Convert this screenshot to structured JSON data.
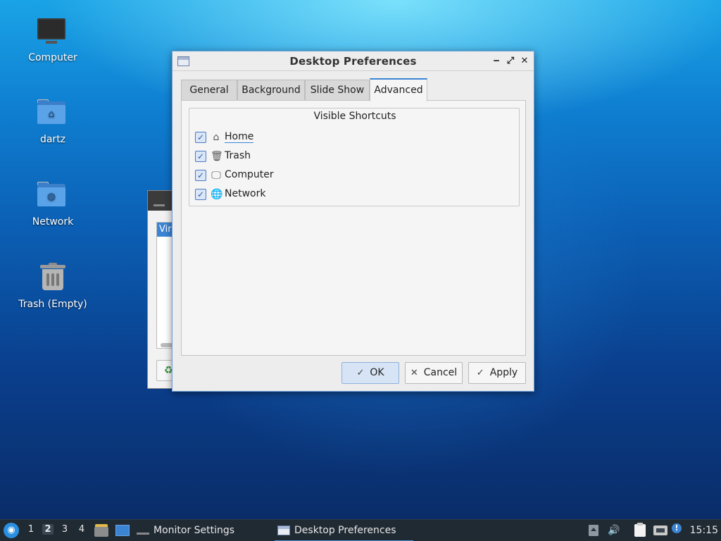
{
  "desktop": {
    "icons": [
      {
        "label": "Computer",
        "icon": "computer-icon"
      },
      {
        "label": "dartz",
        "icon": "home-folder-icon"
      },
      {
        "label": "Network",
        "icon": "network-folder-icon"
      },
      {
        "label": "Trash (Empty)",
        "icon": "trash-icon"
      }
    ]
  },
  "background_window": {
    "list_selected": "Vir"
  },
  "dialog": {
    "title": "Desktop Preferences",
    "controls": {
      "minimize": "‒",
      "maximize": "⤢",
      "close": "✕"
    },
    "tabs": [
      {
        "label": "General",
        "active": false
      },
      {
        "label": "Background",
        "active": false
      },
      {
        "label": "Slide Show",
        "active": false
      },
      {
        "label": "Advanced",
        "active": true
      }
    ],
    "group_title": "Visible Shortcuts",
    "shortcuts": [
      {
        "label": "Home",
        "checked": true,
        "icon": "home-icon",
        "glyph": "⌂"
      },
      {
        "label": "Trash",
        "checked": true,
        "icon": "trash-icon",
        "glyph": "🗑"
      },
      {
        "label": "Computer",
        "checked": true,
        "icon": "monitor-icon",
        "glyph": "🖵"
      },
      {
        "label": "Network",
        "checked": true,
        "icon": "globe-icon",
        "glyph": "🌐"
      }
    ],
    "check_glyph": "✓",
    "buttons": {
      "ok": {
        "label": "OK",
        "icon": "✓"
      },
      "cancel": {
        "label": "Cancel",
        "icon": "✕"
      },
      "apply": {
        "label": "Apply",
        "icon": "✓"
      }
    }
  },
  "taskbar": {
    "start_glyph": "◉",
    "workspaces": [
      "1",
      "2",
      "3",
      "4"
    ],
    "active_workspace": "2",
    "tasks": [
      {
        "label": "Monitor Settings",
        "active": false
      },
      {
        "label": "Desktop Preferences",
        "active": true
      }
    ],
    "tray": {
      "volume": "🔊",
      "update": "!"
    },
    "clock": "15:15"
  },
  "colors": {
    "accent": "#3b84d4",
    "taskbar_bg": "#202a33",
    "desktop_top": "#1aa3e6",
    "desktop_bottom": "#0a2a63"
  }
}
